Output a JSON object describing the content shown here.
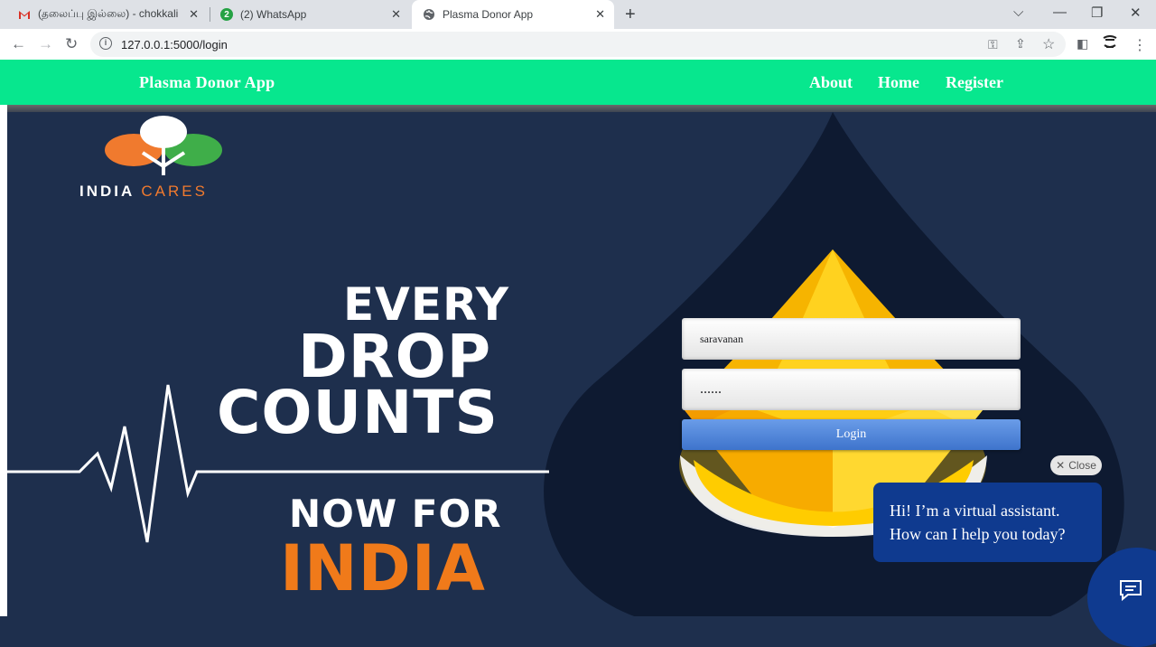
{
  "browser": {
    "tabs": [
      {
        "title": "(தலைப்பு இல்லை) - chokkali",
        "icon": "gmail-icon"
      },
      {
        "title": "(2) WhatsApp",
        "icon": "whatsapp-icon",
        "badge": "2"
      },
      {
        "title": "Plasma Donor App",
        "icon": "globe-icon",
        "active": true
      }
    ],
    "url": "127.0.0.1:5000/login"
  },
  "nav": {
    "brand": "Plasma Donor App",
    "links": [
      "About",
      "Home",
      "Register"
    ]
  },
  "hero": {
    "logo": {
      "part1": "INDIA",
      "part2": "CARES"
    },
    "slogan": [
      "EVERY",
      "DROP",
      "COUNTS",
      "NOW FOR",
      "INDIA"
    ]
  },
  "login": {
    "username": "saravanan",
    "password": "......",
    "button": "Login"
  },
  "chat": {
    "close_label": "Close",
    "greeting_line1": "Hi! I’m a virtual assistant.",
    "greeting_line2": "How can I help you today?"
  },
  "colors": {
    "nav_green": "#07e78e",
    "hero_navy": "#1e2f4d",
    "chat_blue": "#0f3a8f",
    "logo_orange": "#f07a2e",
    "logo_green": "#3fae49"
  }
}
